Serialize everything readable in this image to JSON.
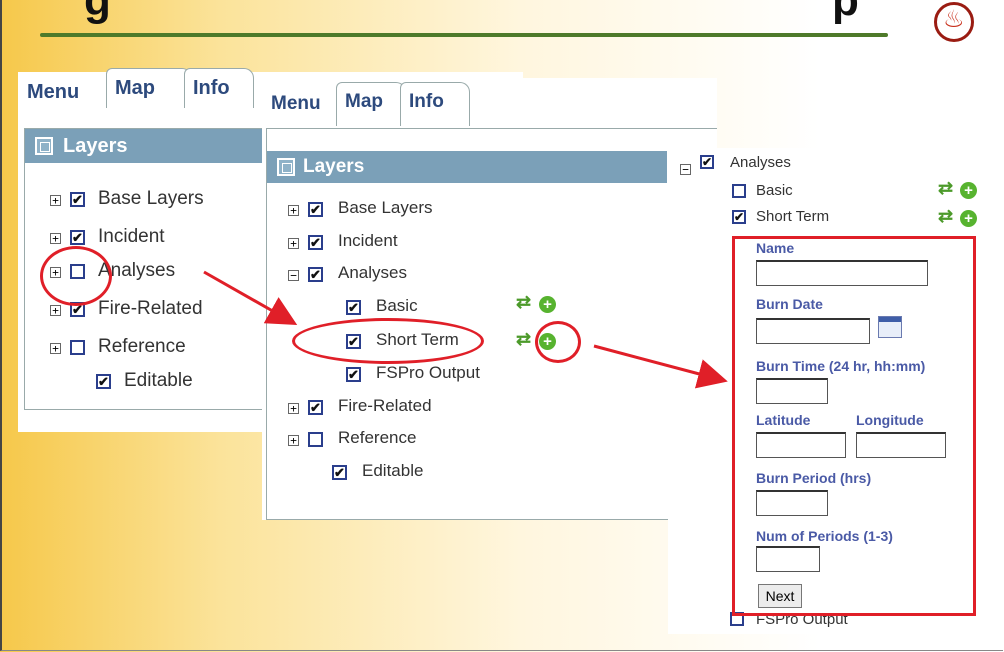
{
  "tabs": [
    "Menu",
    "Map",
    "Info"
  ],
  "layers_header": "Layers",
  "panel1": {
    "rows": [
      {
        "label": "Base Layers",
        "checked": true,
        "expander": "+"
      },
      {
        "label": "Incident",
        "checked": true,
        "expander": "+"
      },
      {
        "label": "Analyses",
        "checked": false,
        "expander": "+"
      },
      {
        "label": "Fire-Related",
        "checked": true,
        "expander": "+"
      },
      {
        "label": "Reference",
        "checked": false,
        "expander": "+"
      },
      {
        "label": "Editable",
        "checked": true,
        "expander": ""
      }
    ]
  },
  "panel2": {
    "rows": [
      {
        "label": "Base Layers",
        "checked": true,
        "expander": "+"
      },
      {
        "label": "Incident",
        "checked": true,
        "expander": "+"
      },
      {
        "label": "Analyses",
        "checked": true,
        "expander": "−"
      },
      {
        "label": "Basic",
        "checked": true,
        "expander": ""
      },
      {
        "label": "Short Term",
        "checked": true,
        "expander": ""
      },
      {
        "label": "FSPro Output",
        "checked": true,
        "expander": ""
      },
      {
        "label": "Fire-Related",
        "checked": true,
        "expander": "+"
      },
      {
        "label": "Reference",
        "checked": false,
        "expander": "+"
      },
      {
        "label": "Editable",
        "checked": true,
        "expander": ""
      }
    ]
  },
  "panel3": {
    "analyses_label": "Analyses",
    "basic_label": "Basic",
    "short_term_label": "Short Term",
    "fspro_label": "FSPro Output",
    "form": {
      "name_label": "Name",
      "burn_date_label": "Burn Date",
      "burn_time_label": "Burn Time (24 hr, hh:mm)",
      "latitude_label": "Latitude",
      "longitude_label": "Longitude",
      "burn_period_label": "Burn Period (hrs)",
      "num_periods_label": "Num of Periods (1-3)",
      "next_label": "Next",
      "name_value": "",
      "burn_date_value": "",
      "burn_time_value": "",
      "latitude_value": "",
      "longitude_value": "",
      "burn_period_value": "",
      "num_periods_value": ""
    }
  },
  "icons": {
    "check": "✔",
    "refresh": "⇄",
    "add": "+",
    "flame": "♨"
  },
  "colors": {
    "accent_red": "#e01f28",
    "header_blue": "#7ba0b8",
    "tab_text": "#2d4a7d",
    "form_label": "#4a5aa6",
    "rule_green": "#4e7a2a"
  }
}
